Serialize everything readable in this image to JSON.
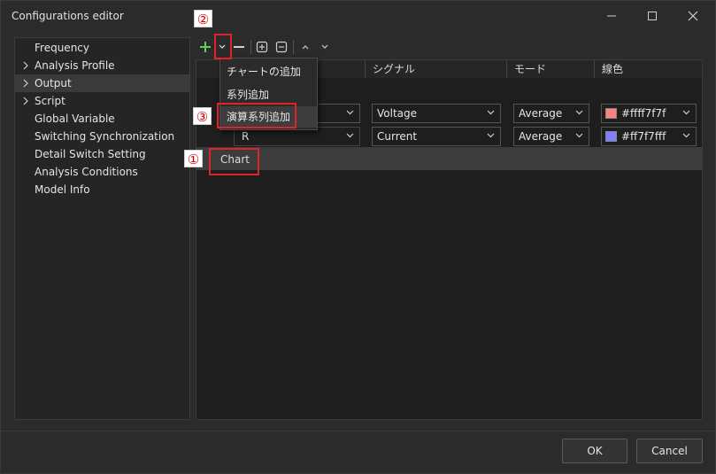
{
  "window": {
    "title": "Configurations editor"
  },
  "sidebar": {
    "items": [
      {
        "label": "Frequency",
        "expandable": false
      },
      {
        "label": "Analysis Profile",
        "expandable": true
      },
      {
        "label": "Output",
        "expandable": true,
        "selected": true
      },
      {
        "label": "Script",
        "expandable": true
      },
      {
        "label": "Global Variable",
        "expandable": false
      },
      {
        "label": "Switching Synchronization",
        "expandable": false
      },
      {
        "label": "Detail Switch Setting",
        "expandable": false
      },
      {
        "label": "Analysis Conditions",
        "expandable": false
      },
      {
        "label": "Model Info",
        "expandable": false
      }
    ]
  },
  "toolbar": {
    "icons": [
      "add-icon",
      "dropdown-arrow-icon",
      "remove-icon",
      "expand-all-icon",
      "collapse-all-icon",
      "move-up-icon",
      "move-down-icon"
    ]
  },
  "table": {
    "columns": [
      "シグナル",
      "モード",
      "線色"
    ],
    "rows": [
      {
        "name": "",
        "signal": "Voltage",
        "mode": "Average",
        "color_label": "#ffff7f7f",
        "color": "#ff7f7f"
      },
      {
        "name": "R",
        "signal": "Current",
        "mode": "Average",
        "color_label": "#ff7f7fff",
        "color": "#7f7fff"
      }
    ],
    "chart_row_label": "Chart"
  },
  "popup_menu": {
    "items": [
      "チャートの追加",
      "系列追加",
      "演算系列追加"
    ],
    "hovered_index": 2
  },
  "annotations": {
    "badge_1": "①",
    "badge_2": "②",
    "badge_3": "③"
  },
  "footer": {
    "ok_label": "OK",
    "cancel_label": "Cancel"
  },
  "colors": {
    "accent_red": "#e0222a",
    "add_green": "#5fcf5f"
  }
}
